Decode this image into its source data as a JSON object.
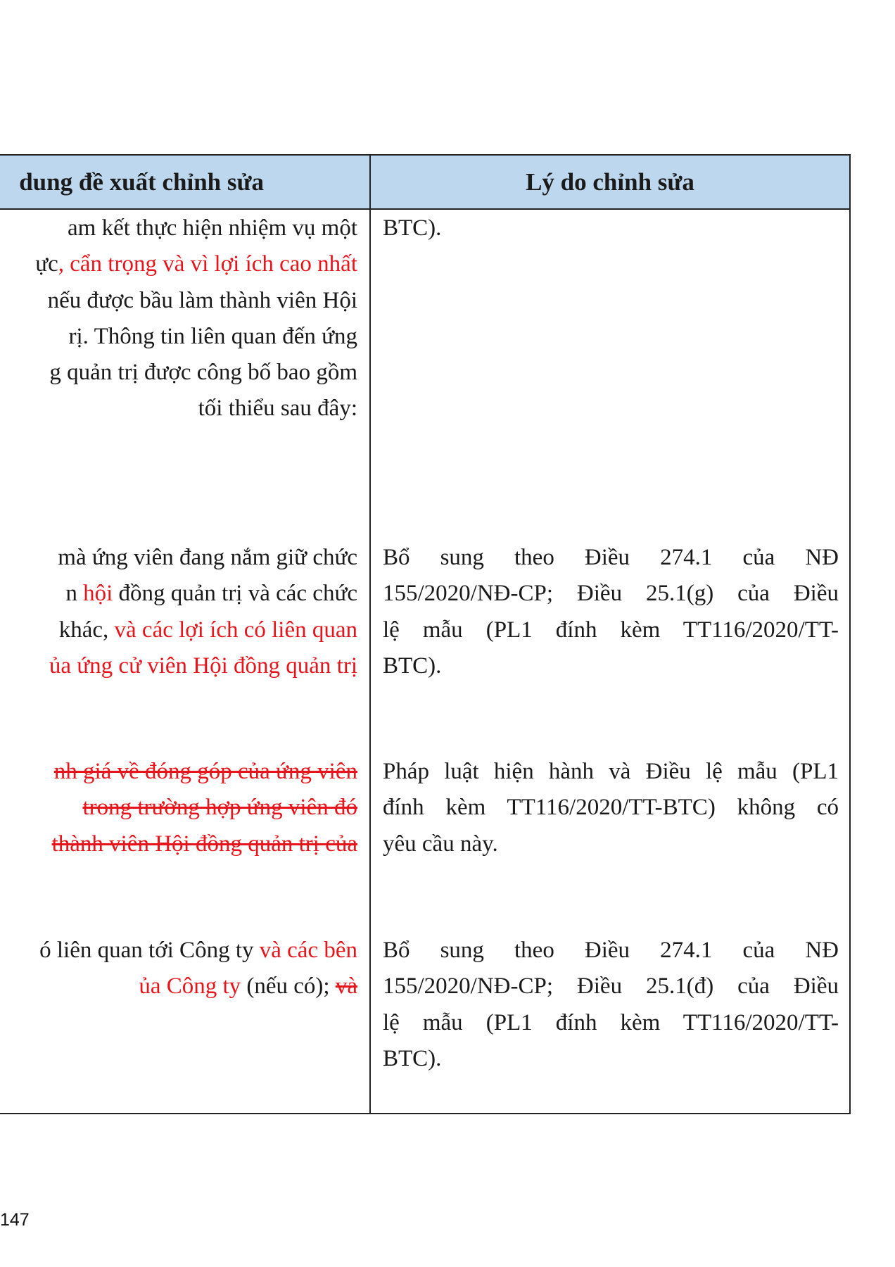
{
  "table": {
    "header": {
      "left": "dung đề xuất chỉnh sửa",
      "right": "Lý do chỉnh sửa"
    },
    "rows": [
      {
        "left_lines": [
          [
            {
              "t": "am kết thực hiện nhiệm vụ một"
            }
          ],
          [
            {
              "t": "ực"
            },
            {
              "t": ", cẩn trọng và vì lợi ích cao nhất",
              "style": "red"
            }
          ],
          [
            {
              "t": "nếu được bầu làm thành viên Hội"
            }
          ],
          [
            {
              "t": "rị. Thông tin liên quan đến ứng"
            }
          ],
          [
            {
              "t": "g quản trị được công bố bao gồm"
            }
          ],
          [
            {
              "t": "tối thiểu sau đây:"
            }
          ]
        ],
        "right_lines": [
          "BTC)."
        ]
      },
      {
        "left_lines": [
          [
            {
              "t": " mà ứng viên đang nắm giữ chức"
            }
          ],
          [
            {
              "t": "n "
            },
            {
              "t": "hội",
              "style": "red"
            },
            {
              "t": " đồng quản trị và các chức"
            }
          ],
          [
            {
              "t": " khác, "
            },
            {
              "t": "và các lợi ích có liên quan",
              "style": "red"
            }
          ],
          [
            {
              "t": "ủa ứng cử viên Hội đồng quản trị",
              "style": "red"
            }
          ]
        ],
        "right_lines": [
          "Bổ sung theo Điều 274.1 của NĐ",
          "155/2020/NĐ-CP; Điều 25.1(g) của Điều",
          "lệ mẫu (PL1 đính kèm TT116/2020/TT-",
          "BTC)."
        ]
      },
      {
        "left_lines": [
          [
            {
              "t": "nh giá về đóng góp của ứng viên",
              "style": "red strike"
            }
          ],
          [
            {
              "t": " trong trường hợp ứng viên đó",
              "style": "red strike"
            }
          ],
          [
            {
              "t": "thành viên Hội đồng quản trị của",
              "style": "red strike"
            }
          ]
        ],
        "right_lines": [
          "Pháp luật hiện hành và Điều lệ mẫu (PL1",
          "đính kèm TT116/2020/TT-BTC) không có",
          "yêu cầu này."
        ]
      },
      {
        "left_lines": [
          [
            {
              "t": "ó liên quan tới Công ty "
            },
            {
              "t": "và các bên",
              "style": "red"
            }
          ],
          [
            {
              "t": "ủa Công ty",
              "style": "red"
            },
            {
              "t": " (nếu có); "
            },
            {
              "t": "và",
              "style": "red strike"
            }
          ]
        ],
        "right_lines": [
          "Bổ sung theo Điều 274.1 của NĐ",
          "155/2020/NĐ-CP; Điều 25.1(đ) của Điều",
          "lệ mẫu (PL1 đính kèm TT116/2020/TT-",
          "BTC)."
        ]
      }
    ]
  },
  "page_number": "147",
  "colors": {
    "header_bg": "#bdd7ee",
    "red_text": "#e8141b",
    "border": "#222222"
  }
}
